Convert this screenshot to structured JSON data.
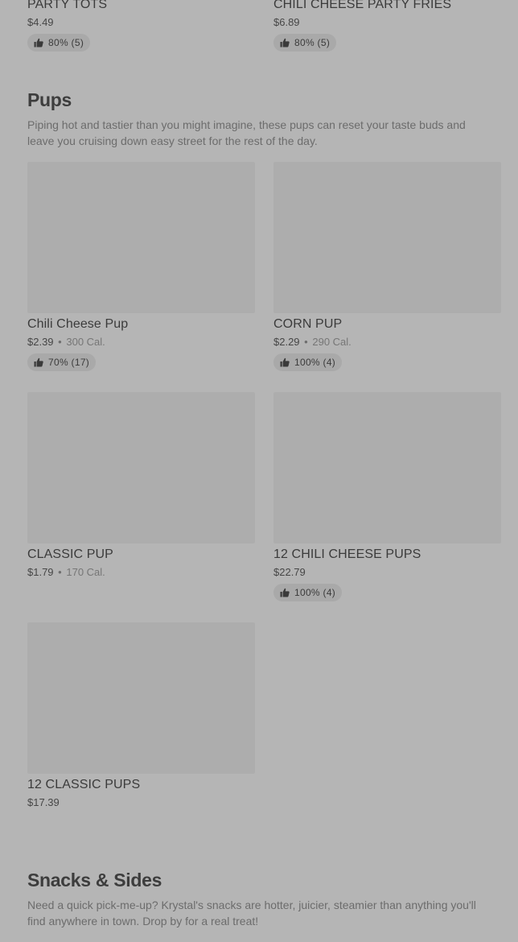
{
  "top_items": [
    {
      "name": "PARTY TOTS",
      "price": "$4.49",
      "rating": "80% (5)"
    },
    {
      "name": "CHILI CHEESE PARTY FRIES",
      "price": "$6.89",
      "rating": "80% (5)"
    }
  ],
  "pups": {
    "title": "Pups",
    "description": "Piping hot and tastier than you might imagine, these pups can reset your taste buds and leave you cruising down easy street for the rest of the day.",
    "items": [
      {
        "name": "Chili Cheese Pup",
        "price": "$2.39",
        "separator": "•",
        "calories": "300 Cal.",
        "rating": "70% (17)"
      },
      {
        "name": "CORN PUP",
        "price": "$2.29",
        "separator": "•",
        "calories": "290 Cal.",
        "rating": "100% (4)"
      },
      {
        "name": "CLASSIC PUP",
        "price": "$1.79",
        "separator": "•",
        "calories": "170 Cal."
      },
      {
        "name": "12 CHILI CHEESE PUPS",
        "price": "$22.79",
        "rating": "100% (4)"
      },
      {
        "name": "12 CLASSIC PUPS",
        "price": "$17.39"
      }
    ]
  },
  "snacks": {
    "title": "Snacks & Sides",
    "description": "Need a quick pick-me-up? Krystal's snacks are hotter, juicier, steamier than anything you'll find anywhere in town. Drop by for a real treat!"
  },
  "icons": {
    "rating": "thumbs-up-icon"
  },
  "colors": {
    "background": "#b5b5b5",
    "image_placeholder": "#adadad",
    "badge": "#a9a9a9"
  }
}
